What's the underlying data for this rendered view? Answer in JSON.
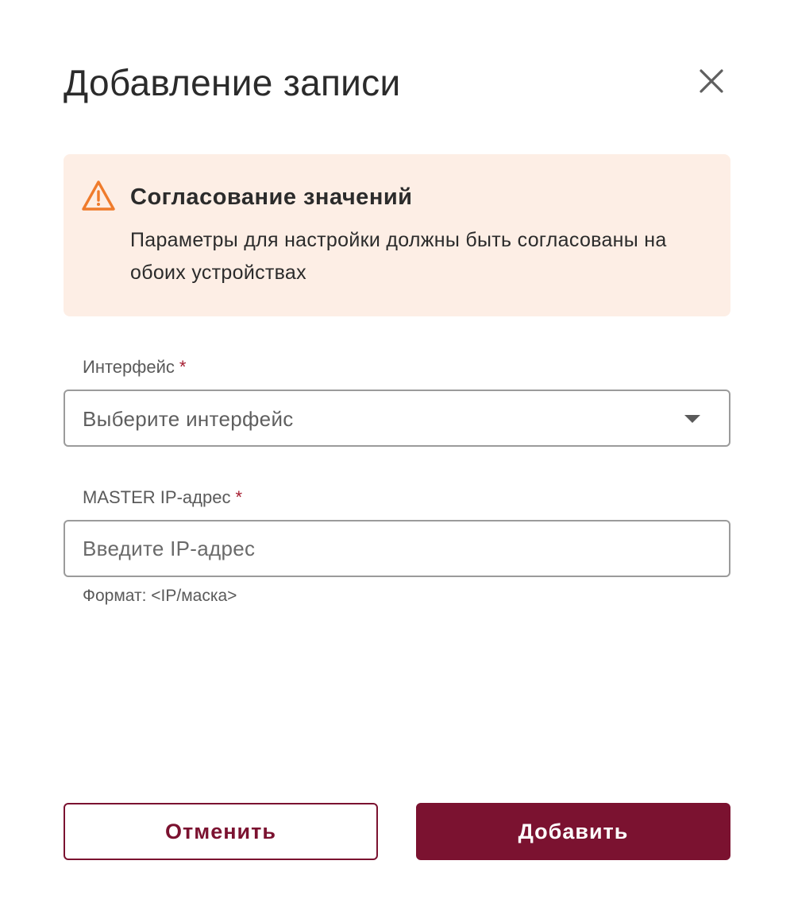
{
  "dialog": {
    "title": "Добавление записи"
  },
  "alert": {
    "title": "Согласование значений",
    "text": "Параметры для настройки должны быть согласованы на обоих устройствах",
    "icon": "warning-triangle-icon",
    "background_color": "#fdeee5",
    "icon_color": "#ef7b2c"
  },
  "fields": {
    "interface": {
      "label": "Интерфейс",
      "required_mark": "*",
      "placeholder": "Выберите интерфейс"
    },
    "master_ip": {
      "label": "MASTER IP-адрес",
      "required_mark": "*",
      "placeholder": "Введите IP-адрес",
      "value": "",
      "hint": "Формат: <IP/маска>"
    }
  },
  "actions": {
    "cancel_label": "Отменить",
    "submit_label": "Добавить"
  },
  "colors": {
    "accent": "#7b1230",
    "required": "#a51c30"
  }
}
